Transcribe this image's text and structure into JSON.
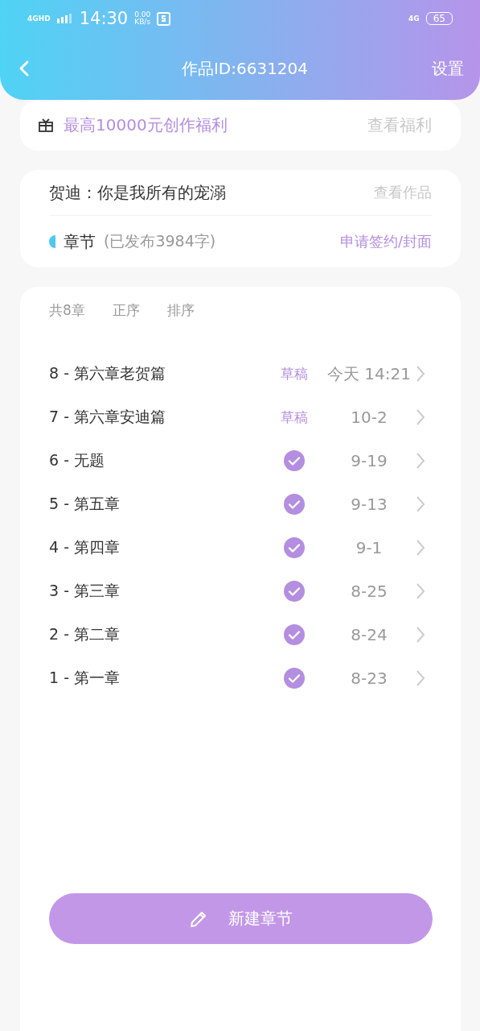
{
  "status_bar": {
    "network": "4GHD",
    "time": "14:30",
    "speed": "0.00",
    "speed_unit": "KB/s",
    "network_right": "4G",
    "battery": "65"
  },
  "nav": {
    "title": "作品ID:6631204",
    "action": "设置"
  },
  "welfare": {
    "text": "最高10000元创作福利",
    "link": "查看福利"
  },
  "work": {
    "title": "贺迪：你是我所有的宠溺",
    "link": "查看作品",
    "section": "章节",
    "published_note": "(已发布3984字)",
    "apply": "申请签约/封面"
  },
  "toolbar": {
    "count": "共8章",
    "order": "正序",
    "sort": "排序"
  },
  "chapters": [
    {
      "title": "8 - 第六章老贺篇",
      "published": false,
      "status": "草稿",
      "date": "今天 14:21"
    },
    {
      "title": "7 - 第六章安迪篇",
      "published": false,
      "status": "草稿",
      "date": "10-2"
    },
    {
      "title": "6 - 无题",
      "published": true,
      "date": "9-19"
    },
    {
      "title": "5 - 第五章",
      "published": true,
      "date": "9-13"
    },
    {
      "title": "4 - 第四章",
      "published": true,
      "date": "9-1"
    },
    {
      "title": "3 - 第三章",
      "published": true,
      "date": "8-25"
    },
    {
      "title": "2 - 第二章",
      "published": true,
      "date": "8-24"
    },
    {
      "title": "1 - 第一章",
      "published": true,
      "date": "8-23"
    }
  ],
  "new_button": "新建章节"
}
